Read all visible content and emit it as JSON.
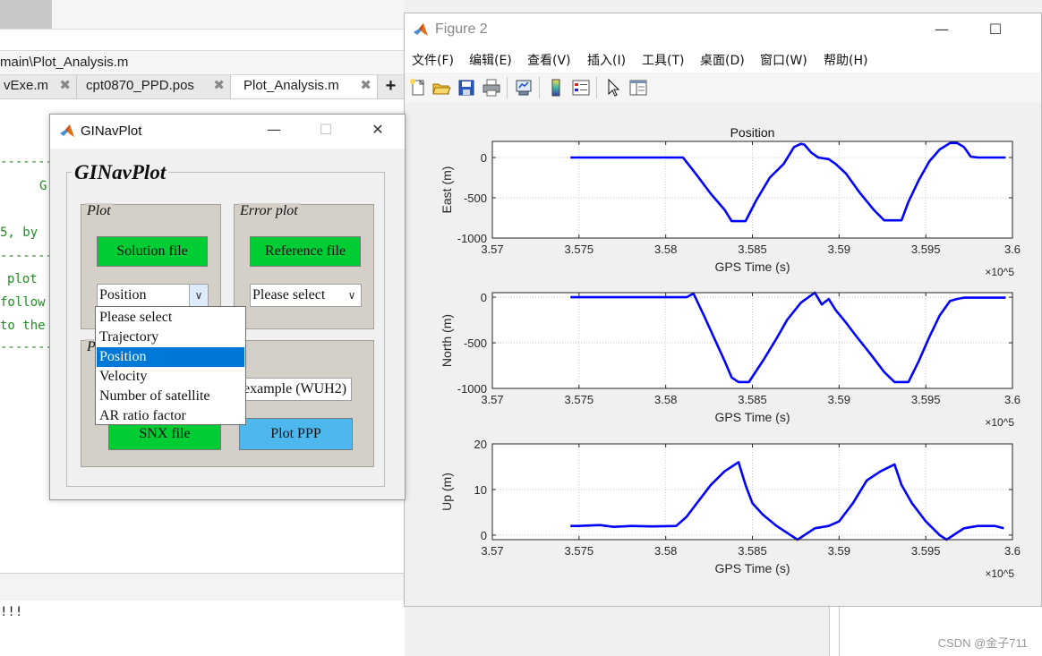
{
  "editor": {
    "path": "main\\Plot_Analysis.m",
    "tabs": [
      {
        "label": "vExe.m",
        "close": "✖"
      },
      {
        "label": "cpt0870_PPD.pos",
        "close": "✖"
      },
      {
        "label": "Plot_Analysis.m",
        "close": "✖"
      }
    ],
    "tab_add": "+",
    "code_lines": [
      "G",
      "5, by",
      "plot",
      "follow",
      "to the"
    ],
    "cmd_text": "!!!"
  },
  "figure": {
    "title": "Figure 2",
    "window_controls": {
      "minimize": "—",
      "maximize": "☐"
    },
    "menu": [
      "文件(F)",
      "编辑(E)",
      "查看(V)",
      "插入(I)",
      "工具(T)",
      "桌面(D)",
      "窗口(W)",
      "帮助(H)"
    ],
    "toolbar_icons": [
      "new-figure-icon",
      "open-file-icon",
      "save-icon",
      "print-icon",
      "link-plot-icon",
      "colorbar-icon",
      "legend-icon",
      "pointer-icon",
      "property-editor-icon"
    ]
  },
  "gui": {
    "title": "GINavPlot",
    "window_controls": {
      "minimize": "—",
      "maximize": "☐",
      "close": "✕"
    },
    "heading": "GINavPlot",
    "plot_panel": {
      "title": "Plot",
      "button": "Solution file",
      "select_value": "Position"
    },
    "error_panel": {
      "title": "Error plot",
      "button": "Reference file",
      "select_value": "Please select"
    },
    "third_panel": {
      "title_visible": "P",
      "input_value": "example (WUH2)",
      "button_snx": "SNX file",
      "button_ppp": "Plot PPP"
    },
    "dropdown_options": [
      "Please select",
      "Trajectory",
      "Position",
      "Velocity",
      "Number of satellite",
      "AR ratio factor"
    ],
    "dropdown_selected": "Position",
    "colors": {
      "green_button": "#00cc33",
      "blue_button": "#4db8ee",
      "panel": "#d4d0c8",
      "selection": "#0078d7"
    }
  },
  "watermark": "CSDN @金子711",
  "chart_data": [
    {
      "type": "line",
      "title": "Position",
      "xlabel": "GPS Time (s)",
      "ylabel": "East (m)",
      "x_exponent": "×10^5",
      "xlim": [
        3.57,
        3.6
      ],
      "xticks": [
        "3.57",
        "3.575",
        "3.58",
        "3.585",
        "3.59",
        "3.595",
        "3.6"
      ],
      "ylim": [
        -1000,
        200
      ],
      "yticks": [
        "0",
        "-500",
        "-1000"
      ],
      "grid": true,
      "color": "#0000ff",
      "x": [
        3.5745,
        3.581,
        3.5818,
        3.5826,
        3.5834,
        3.5838,
        3.5842,
        3.5846,
        3.5852,
        3.586,
        3.5868,
        3.5874,
        3.5878,
        3.588,
        3.5884,
        3.5888,
        3.5894,
        3.5898,
        3.5904,
        3.5912,
        3.592,
        3.5926,
        3.5932,
        3.5936,
        3.594,
        3.5946,
        3.5952,
        3.5958,
        3.5964,
        3.5968,
        3.5972,
        3.5976,
        3.598,
        3.5996
      ],
      "y": [
        0,
        0,
        -220,
        -450,
        -650,
        -790,
        -790,
        -790,
        -540,
        -250,
        -80,
        130,
        170,
        160,
        60,
        0,
        -20,
        -80,
        -200,
        -440,
        -650,
        -780,
        -780,
        -780,
        -550,
        -280,
        -50,
        100,
        180,
        180,
        130,
        10,
        0,
        0
      ]
    },
    {
      "type": "line",
      "xlabel": "GPS Time (s)",
      "ylabel": "North (m)",
      "x_exponent": "×10^5",
      "xlim": [
        3.57,
        3.6
      ],
      "xticks": [
        "3.57",
        "3.575",
        "3.58",
        "3.585",
        "3.59",
        "3.595",
        "3.6"
      ],
      "ylim": [
        -1000,
        50
      ],
      "yticks": [
        "0",
        "-500",
        "-1000"
      ],
      "grid": true,
      "color": "#0000ff",
      "x": [
        3.5745,
        3.5812,
        3.5816,
        3.5822,
        3.5828,
        3.5834,
        3.5838,
        3.5842,
        3.5848,
        3.5856,
        3.5864,
        3.587,
        3.5878,
        3.5886,
        3.589,
        3.5894,
        3.5898,
        3.5904,
        3.591,
        3.5918,
        3.5926,
        3.5932,
        3.5936,
        3.594,
        3.5946,
        3.5952,
        3.5958,
        3.5964,
        3.5968,
        3.5972,
        3.5996
      ],
      "y": [
        0,
        0,
        40,
        -200,
        -450,
        -700,
        -880,
        -930,
        -930,
        -700,
        -450,
        -250,
        -60,
        50,
        -80,
        -20,
        -140,
        -280,
        -430,
        -620,
        -820,
        -930,
        -930,
        -930,
        -700,
        -440,
        -200,
        -40,
        -20,
        -5,
        -5
      ]
    },
    {
      "type": "line",
      "xlabel": "GPS Time (s)",
      "ylabel": "Up (m)",
      "x_exponent": "×10^5",
      "xlim": [
        3.57,
        3.6
      ],
      "xticks": [
        "3.57",
        "3.575",
        "3.58",
        "3.585",
        "3.59",
        "3.595",
        "3.6"
      ],
      "ylim": [
        -1,
        20
      ],
      "yticks": [
        "20",
        "10",
        "0"
      ],
      "grid": true,
      "color": "#0000ff",
      "x": [
        3.5745,
        3.575,
        3.5762,
        3.577,
        3.578,
        3.5792,
        3.5806,
        3.5812,
        3.5818,
        3.5826,
        3.5834,
        3.5842,
        3.5846,
        3.585,
        3.5856,
        3.5864,
        3.5872,
        3.5876,
        3.588,
        3.5886,
        3.5894,
        3.59,
        3.5908,
        3.5916,
        3.5924,
        3.5932,
        3.5936,
        3.5942,
        3.595,
        3.5958,
        3.5962,
        3.5966,
        3.5972,
        3.598,
        3.599,
        3.5995
      ],
      "y": [
        2,
        2,
        2.2,
        1.8,
        2,
        1.9,
        2,
        4,
        7,
        11,
        14,
        16,
        11,
        7,
        4.5,
        2,
        0,
        -1,
        0,
        1.5,
        2,
        3,
        7,
        12,
        14,
        15.5,
        11,
        7,
        3,
        0,
        -1,
        0,
        1.5,
        2,
        2,
        1.5
      ]
    }
  ]
}
